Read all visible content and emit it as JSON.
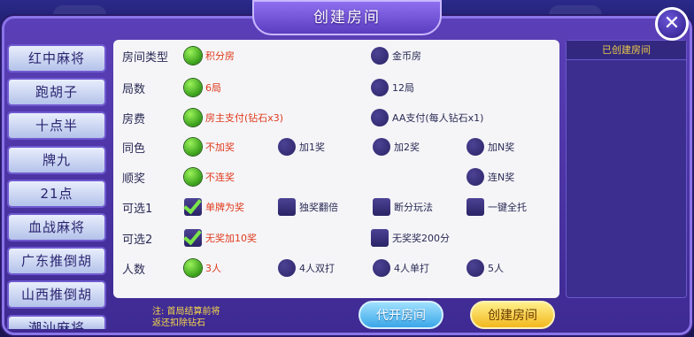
{
  "title": "创建房间",
  "close_icon": "close-icon",
  "sidebar": {
    "items": [
      {
        "label": "红中麻将"
      },
      {
        "label": "跑胡子"
      },
      {
        "label": "十点半"
      },
      {
        "label": "牌九"
      },
      {
        "label": "21点"
      },
      {
        "label": "血战麻将"
      },
      {
        "label": "广东推倒胡"
      },
      {
        "label": "山西推倒胡"
      },
      {
        "label": "潮汕麻将"
      }
    ]
  },
  "rows": [
    {
      "label": "房间类型",
      "options": [
        {
          "text": "积分房",
          "type": "radio",
          "selected": true
        },
        {
          "text": "金币房",
          "type": "radio",
          "selected": false
        }
      ]
    },
    {
      "label": "局数",
      "options": [
        {
          "text": "6局",
          "type": "radio",
          "selected": true
        },
        {
          "text": "12局",
          "type": "radio",
          "selected": false
        }
      ]
    },
    {
      "label": "房费",
      "options": [
        {
          "text": "房主支付(钻石x3)",
          "type": "radio",
          "selected": true
        },
        {
          "text": "AA支付(每人钻石x1)",
          "type": "radio",
          "selected": false
        }
      ]
    },
    {
      "label": "同色",
      "options": [
        {
          "text": "不加奖",
          "type": "radio",
          "selected": true
        },
        {
          "text": "加1奖",
          "type": "radio",
          "selected": false
        },
        {
          "text": "加2奖",
          "type": "radio",
          "selected": false
        },
        {
          "text": "加N奖",
          "type": "radio",
          "selected": false
        }
      ]
    },
    {
      "label": "顺奖",
      "options": [
        {
          "text": "不连奖",
          "type": "radio",
          "selected": true
        },
        {
          "text": "连N奖",
          "type": "radio",
          "selected": false
        }
      ]
    },
    {
      "label": "可选1",
      "options": [
        {
          "text": "单牌为奖",
          "type": "check",
          "selected": true
        },
        {
          "text": "独奖翻倍",
          "type": "check",
          "selected": false
        },
        {
          "text": "断分玩法",
          "type": "check",
          "selected": false
        },
        {
          "text": "一键全托",
          "type": "check",
          "selected": false
        }
      ]
    },
    {
      "label": "可选2",
      "options": [
        {
          "text": "无奖加10奖",
          "type": "check",
          "selected": true
        },
        {
          "text": "无奖奖200分",
          "type": "check",
          "selected": false
        }
      ]
    },
    {
      "label": "人数",
      "options": [
        {
          "text": "3人",
          "type": "radio",
          "selected": true
        },
        {
          "text": "4人双打",
          "type": "radio",
          "selected": false
        },
        {
          "text": "4人单打",
          "type": "radio",
          "selected": false
        },
        {
          "text": "5人",
          "type": "radio",
          "selected": false
        }
      ]
    }
  ],
  "note": {
    "line1": "注: 首局结算前将",
    "line2": "返还扣除钻石"
  },
  "buttons": {
    "proxy_label": "代开房间",
    "create_label": "创建房间"
  },
  "right_panel": {
    "title": "已创建房间"
  },
  "colors": {
    "selected_text": "#e03a1c",
    "radio_on": "#4fbf22",
    "note": "#f7d84a"
  }
}
